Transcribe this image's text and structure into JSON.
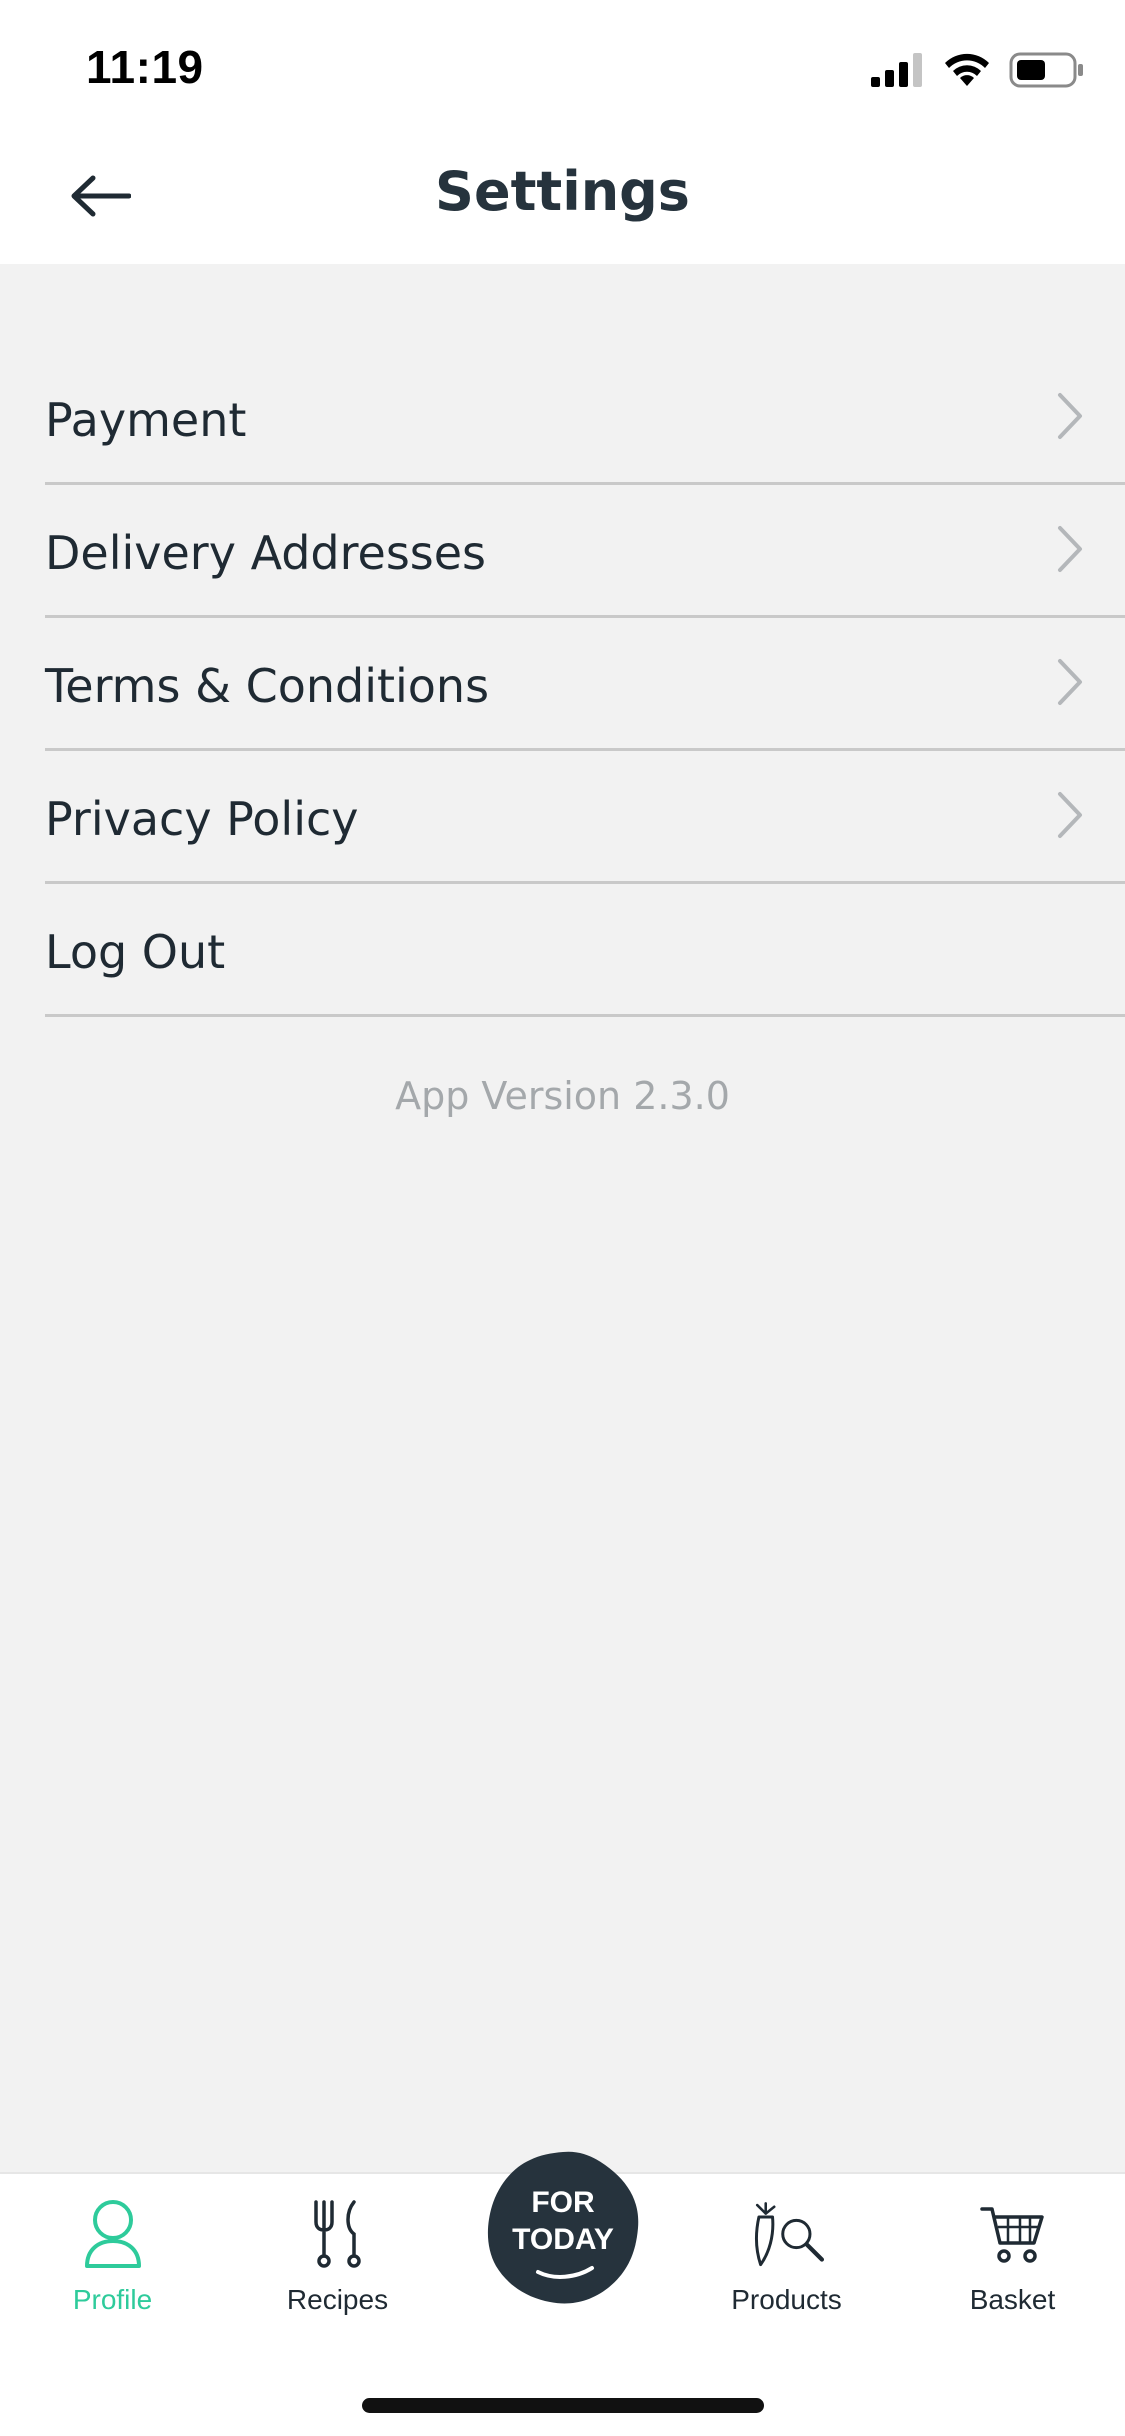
{
  "status_bar": {
    "time": "11:19"
  },
  "header": {
    "title": "Settings",
    "back_icon": "arrow-left-icon"
  },
  "settings_items": [
    {
      "label": "Payment",
      "has_chevron": true
    },
    {
      "label": "Delivery Addresses",
      "has_chevron": true
    },
    {
      "label": "Terms & Conditions",
      "has_chevron": true
    },
    {
      "label": "Privacy Policy",
      "has_chevron": true
    },
    {
      "label": "Log Out",
      "has_chevron": false
    }
  ],
  "app_version": "App Version 2.3.0",
  "tabbar": {
    "tabs": [
      {
        "label": "Profile",
        "icon": "profile-icon",
        "active": true
      },
      {
        "label": "Recipes",
        "icon": "cutlery-icon",
        "active": false
      },
      {
        "label": "Products",
        "icon": "carrot-search-icon",
        "active": false
      },
      {
        "label": "Basket",
        "icon": "cart-icon",
        "active": false
      }
    ],
    "center_button": {
      "line1": "FOR",
      "line2": "TODAY"
    }
  },
  "colors": {
    "accent": "#2ecb9b",
    "text_dark": "#1f2a33",
    "background": "#f2f2f2",
    "divider": "#c9c9c9",
    "muted": "#a4a8ab"
  }
}
